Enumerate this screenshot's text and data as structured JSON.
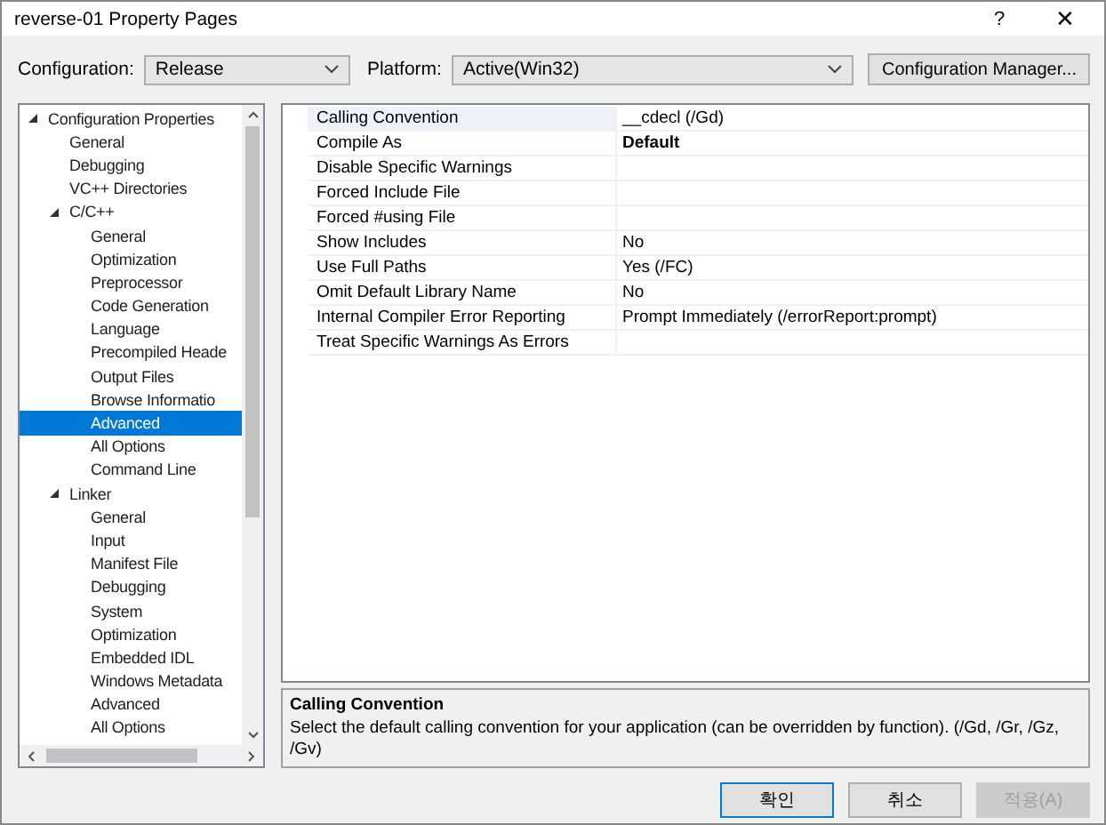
{
  "window": {
    "title": "reverse-01 Property Pages",
    "help": "?",
    "close": "✕"
  },
  "configuration": {
    "label": "Configuration:",
    "value": "Release"
  },
  "platform": {
    "label": "Platform:",
    "value": "Active(Win32)"
  },
  "config_manager_button": "Configuration Manager...",
  "tree": [
    {
      "label": "Configuration Properties",
      "selected": false,
      "expanded": true,
      "children": [
        {
          "label": "General",
          "selected": false
        },
        {
          "label": "Debugging",
          "selected": false
        },
        {
          "label": "VC++ Directories",
          "selected": false
        },
        {
          "label": "C/C++",
          "selected": false,
          "expanded": true,
          "children": [
            {
              "label": "General",
              "selected": false
            },
            {
              "label": "Optimization",
              "selected": false
            },
            {
              "label": "Preprocessor",
              "selected": false
            },
            {
              "label": "Code Generation",
              "selected": false
            },
            {
              "label": "Language",
              "selected": false
            },
            {
              "label": "Precompiled Heade",
              "selected": false
            },
            {
              "label": "Output Files",
              "selected": false
            },
            {
              "label": "Browse Informatio",
              "selected": false
            },
            {
              "label": "Advanced",
              "selected": true
            },
            {
              "label": "All Options",
              "selected": false
            },
            {
              "label": "Command Line",
              "selected": false
            }
          ]
        },
        {
          "label": "Linker",
          "selected": false,
          "expanded": true,
          "children": [
            {
              "label": "General",
              "selected": false
            },
            {
              "label": "Input",
              "selected": false
            },
            {
              "label": "Manifest File",
              "selected": false
            },
            {
              "label": "Debugging",
              "selected": false
            },
            {
              "label": "System",
              "selected": false
            },
            {
              "label": "Optimization",
              "selected": false
            },
            {
              "label": "Embedded IDL",
              "selected": false
            },
            {
              "label": "Windows Metadata",
              "selected": false
            },
            {
              "label": "Advanced",
              "selected": false
            },
            {
              "label": "All Options",
              "selected": false
            }
          ]
        }
      ]
    }
  ],
  "properties": [
    {
      "name": "Calling Convention",
      "value": "__cdecl (/Gd)",
      "bold": false,
      "selected": true
    },
    {
      "name": "Compile As",
      "value": "Default",
      "bold": true,
      "selected": false
    },
    {
      "name": "Disable Specific Warnings",
      "selected": false
    },
    {
      "name": "Forced Include File",
      "selected": false
    },
    {
      "name": "Forced #using File",
      "selected": false
    },
    {
      "name": "Show Includes",
      "value": "No",
      "bold": false,
      "selected": false
    },
    {
      "name": "Use Full Paths",
      "value": "Yes (/FC)",
      "bold": false,
      "selected": false
    },
    {
      "name": "Omit Default Library Name",
      "value": "No",
      "bold": false,
      "selected": false
    },
    {
      "name": "Internal Compiler Error Reporting",
      "value": "Prompt Immediately (/errorReport:prompt)",
      "bold": false,
      "selected": false
    },
    {
      "name": "Treat Specific Warnings As Errors",
      "selected": false
    }
  ],
  "description": {
    "title": "Calling Convention",
    "text": "Select the default calling convention for your application (can be overridden by function).     (/Gd, /Gr, /Gz, /Gv)"
  },
  "buttons": [
    {
      "label": "확인",
      "default": true,
      "disabled": false
    },
    {
      "label": "취소",
      "default": false,
      "disabled": false
    },
    {
      "label": "적용(A)",
      "default": false,
      "disabled": true
    }
  ]
}
